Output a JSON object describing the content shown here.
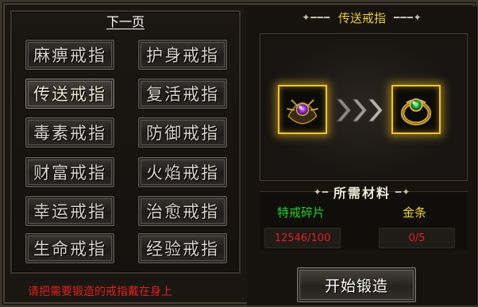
{
  "left_panel": {
    "next_page": "下一页",
    "rings": [
      {
        "label": "麻痹戒指",
        "selected": false
      },
      {
        "label": "护身戒指",
        "selected": false
      },
      {
        "label": "传送戒指",
        "selected": true
      },
      {
        "label": "复活戒指",
        "selected": false
      },
      {
        "label": "毒素戒指",
        "selected": false
      },
      {
        "label": "防御戒指",
        "selected": false
      },
      {
        "label": "财富戒指",
        "selected": false
      },
      {
        "label": "火焰戒指",
        "selected": false
      },
      {
        "label": "幸运戒指",
        "selected": false
      },
      {
        "label": "治愈戒指",
        "selected": false
      },
      {
        "label": "生命戒指",
        "selected": false
      },
      {
        "label": "经验戒指",
        "selected": false
      }
    ],
    "hint": "请把需要锻造的戒指戴在身上"
  },
  "right_panel": {
    "title": "传送戒指",
    "source_slot": {
      "icon": "purple-gem-ring-icon"
    },
    "target_slot": {
      "icon": "green-gem-ring-icon"
    },
    "materials_title": "所需材料",
    "materials": [
      {
        "name": "特戒碎片",
        "value": "12546/100",
        "name_color": "#22d02a"
      },
      {
        "name": "金条",
        "value": "0/5",
        "name_color": "#f2d72c"
      }
    ],
    "forge_button": "开始锻造"
  },
  "colors": {
    "title_yellow": "#f5d63a",
    "hint_red": "#e0201e",
    "slot_glow": "#f0c52a"
  }
}
